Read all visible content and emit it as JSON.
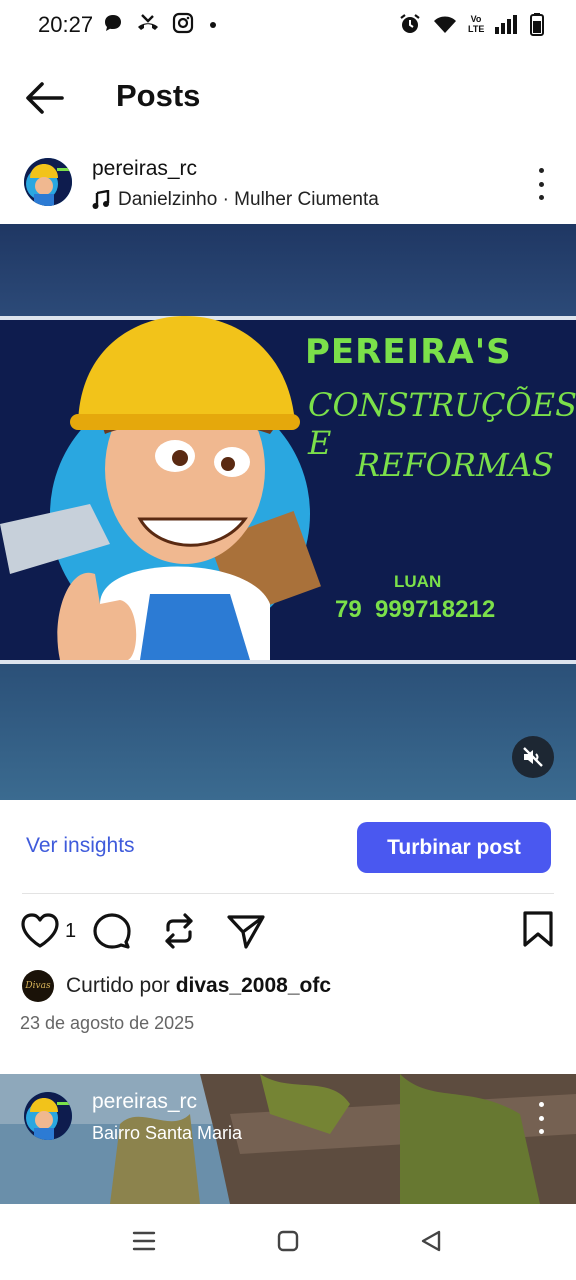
{
  "status_bar": {
    "time": "20:27",
    "left_icons": [
      "chat-bubble-icon",
      "missed-call-icon",
      "instagram-icon",
      "dot-icon"
    ],
    "right_icons": [
      "alarm-icon",
      "wifi-icon",
      "volte-icon",
      "signal-icon",
      "battery-icon"
    ],
    "volte_label": "Vo LTE"
  },
  "header": {
    "title": "Posts"
  },
  "post": {
    "username": "pereiras_rc",
    "audio": "Danielzinho · Mulher Ciumenta",
    "banner": {
      "title": "PEREIRA'S",
      "line2": "CONSTRUÇÕES E",
      "line3": "REFORMAS",
      "name": "LUAN",
      "phone": "79  999718212"
    },
    "insights_label": "Ver insights",
    "boost_label": "Turbinar post",
    "like_count": "1",
    "liked_by_prefix": "Curtido por ",
    "liked_by_user": "divas_2008_ofc",
    "liked_by_avatar_text": "Divas",
    "date": "23 de agosto de 2025",
    "muted": true
  },
  "next_post": {
    "username": "pereiras_rc",
    "location": "Bairro Santa Maria"
  },
  "colors": {
    "accent": "#4a58f0",
    "link": "#3f5bdb",
    "banner_bg": "#0e1c4e",
    "banner_green": "#7be04a",
    "banner_band": "#243b63"
  }
}
